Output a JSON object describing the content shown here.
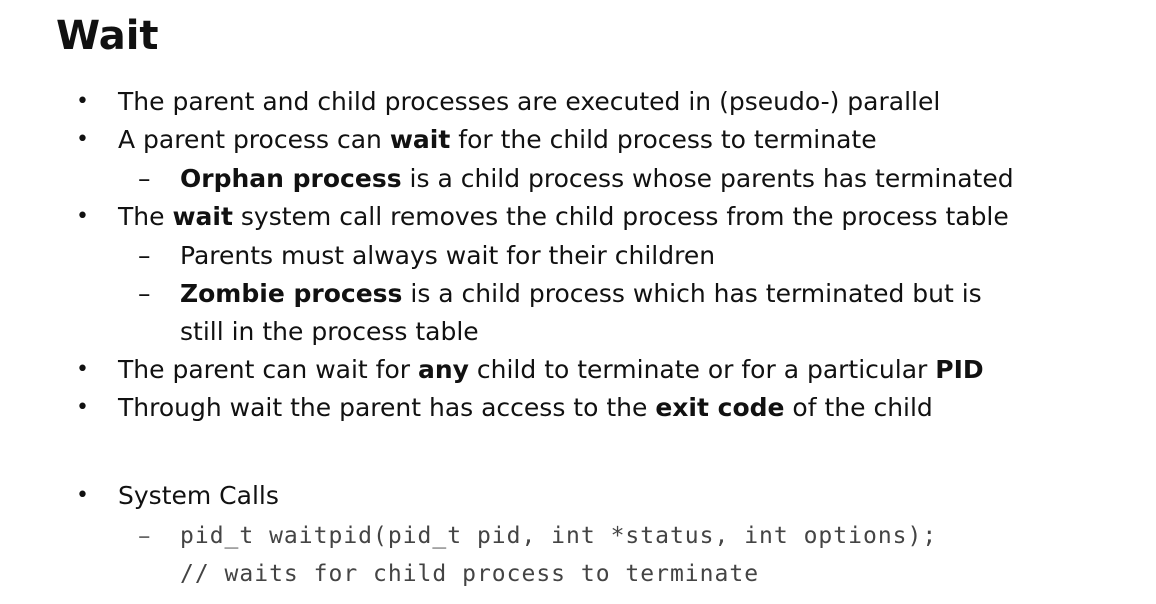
{
  "title": "Wait",
  "bullets": {
    "b1": "The parent and child processes are executed in (pseudo-) parallel",
    "b2_pre": "A parent process can ",
    "b2_bold": "wait",
    "b2_post": " for the child process to terminate",
    "b2_sub1_bold": "Orphan process",
    "b2_sub1_post": " is a child process whose parents has terminated",
    "b3_pre": "The ",
    "b3_bold": "wait",
    "b3_post": " system call removes the child process from the process table",
    "b3_sub1": "Parents must always wait for their children",
    "b3_sub2_bold": "Zombie process",
    "b3_sub2_post": " is a child process which has terminated but is",
    "b3_sub2_cont": "still in the process table",
    "b4_pre": "The parent can wait for ",
    "b4_bold1": "any",
    "b4_mid": " child to terminate or for a particular ",
    "b4_bold2": "PID",
    "b5_pre": "Through wait the parent has access to the ",
    "b5_bold": "exit code",
    "b5_post": " of the child",
    "b6": "System Calls",
    "code_line1": "pid_t waitpid(pid_t pid, int *status, int options);",
    "code_line2": "// waits for child process to terminate"
  },
  "markers": {
    "bullet": "•",
    "dash": "–"
  }
}
